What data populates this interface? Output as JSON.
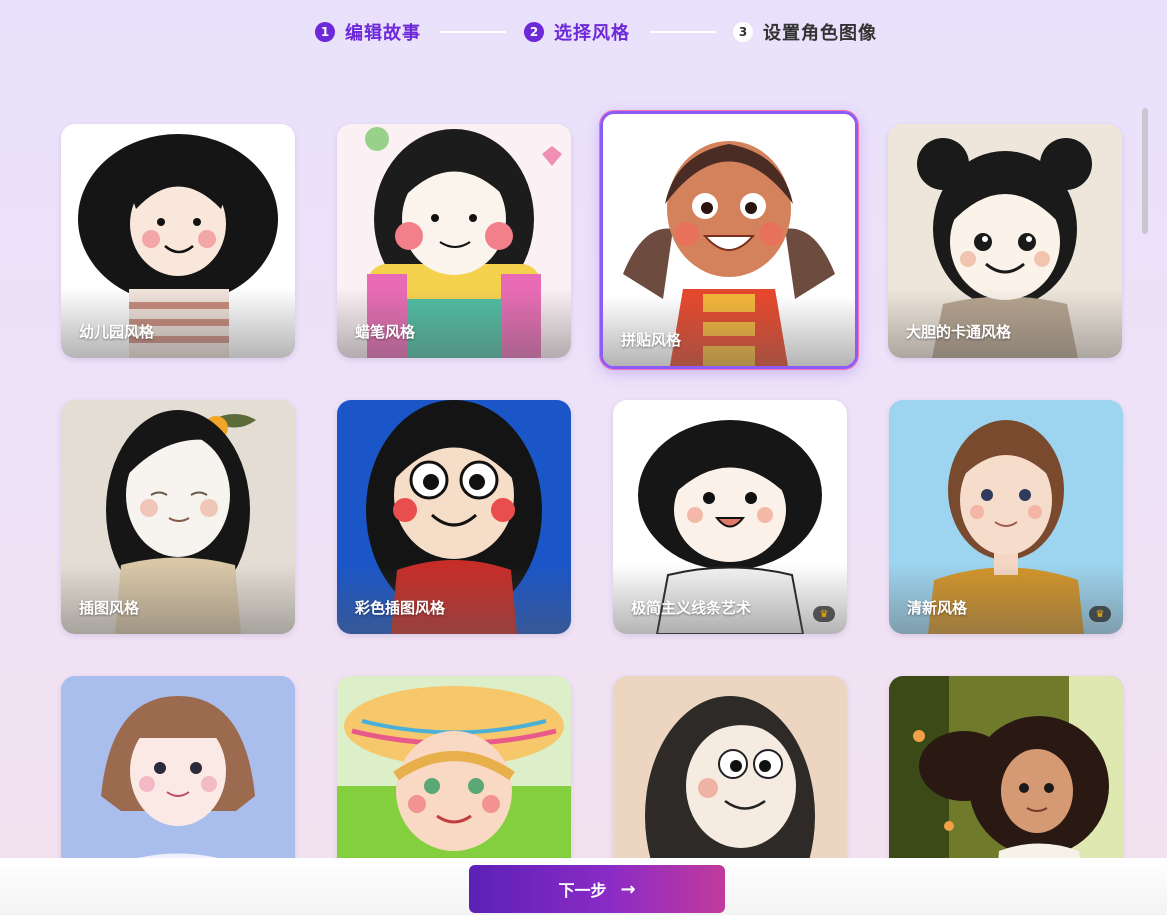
{
  "stepper": {
    "steps": [
      {
        "num": "1",
        "label": "编辑故事",
        "state": "active"
      },
      {
        "num": "2",
        "label": "选择风格",
        "state": "active"
      },
      {
        "num": "3",
        "label": "设置角色图像",
        "state": "pending"
      }
    ]
  },
  "styles": [
    {
      "name": "幼儿园风格",
      "premium": false,
      "selected": false
    },
    {
      "name": "蜡笔风格",
      "premium": false,
      "selected": false
    },
    {
      "name": "拼贴风格",
      "premium": false,
      "selected": true
    },
    {
      "name": "大胆的卡通风格",
      "premium": false,
      "selected": false
    },
    {
      "name": "插图风格",
      "premium": false,
      "selected": false
    },
    {
      "name": "彩色插图风格",
      "premium": false,
      "selected": false
    },
    {
      "name": "极简主义线条艺术",
      "premium": true,
      "selected": false
    },
    {
      "name": "清新风格",
      "premium": true,
      "selected": false
    },
    {
      "name": "",
      "premium": false,
      "selected": false
    },
    {
      "name": "",
      "premium": false,
      "selected": false
    },
    {
      "name": "",
      "premium": false,
      "selected": false
    },
    {
      "name": "",
      "premium": false,
      "selected": false
    }
  ],
  "footer": {
    "next_label": "下一步",
    "next_icon": "arrow-right-icon",
    "arrow_glyph": "→"
  },
  "premium_icon": {
    "name": "crown-icon",
    "glyph": "♛"
  },
  "colors": {
    "accent": "#6d28d9",
    "selected_border": "#8b5cf6",
    "crown": "#f5b400"
  }
}
